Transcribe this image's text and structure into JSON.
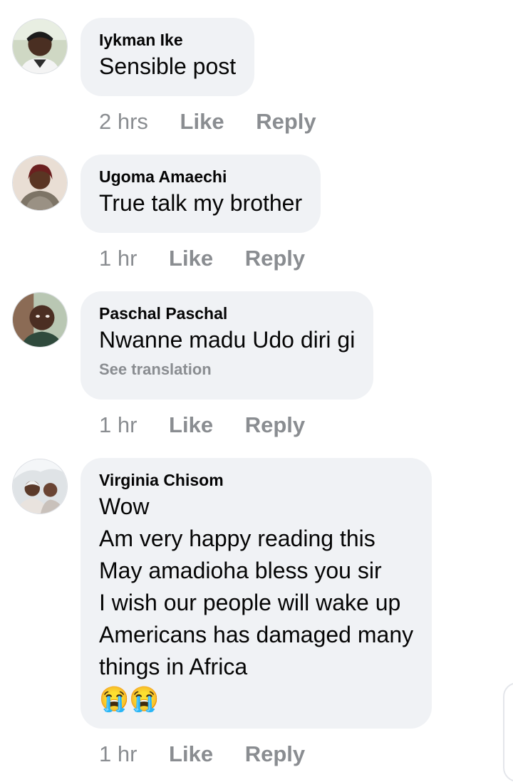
{
  "comments": [
    {
      "author": "Iykman Ike",
      "text": "Sensible post",
      "time": "2 hrs",
      "like_label": "Like",
      "reply_label": "Reply"
    },
    {
      "author": "Ugoma Amaechi",
      "text": "True talk my brother",
      "time": "1 hr",
      "like_label": "Like",
      "reply_label": "Reply"
    },
    {
      "author": "Paschal Paschal",
      "text": "Nwanne madu Udo diri gi",
      "see_translation": "See translation",
      "time": "1 hr",
      "like_label": "Like",
      "reply_label": "Reply"
    },
    {
      "author": "Virginia Chisom",
      "text": "Wow\nAm very happy reading this\nMay amadioha bless you sir\nI wish our people will wake up\nAmericans has damaged many\nthings in Africa",
      "emojis": "😭😭",
      "time": "1 hr",
      "like_label": "Like",
      "reply_label": "Reply"
    }
  ],
  "colors": {
    "bubble_bg": "#f0f2f5",
    "meta_gray": "#8a8d91",
    "text": "#050505"
  },
  "icons": {
    "emoji": "loudly-crying-face-icon"
  }
}
